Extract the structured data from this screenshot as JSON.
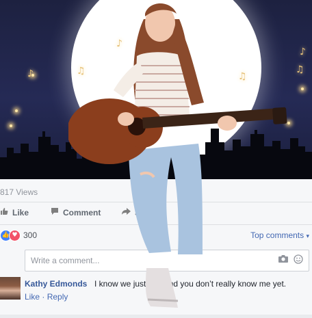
{
  "post": {
    "views": "817 Views"
  },
  "actions": {
    "like": "Like",
    "comment": "Comment",
    "share": "Share"
  },
  "reactions": {
    "count": "300",
    "top_comments": "Top comments"
  },
  "comment_box": {
    "placeholder": "Write a comment..."
  },
  "comment": {
    "author": "Kathy Edmonds",
    "text": "I know we just met and you don’t really know me yet.",
    "like": "Like",
    "separator": " · ",
    "reply": "Reply"
  },
  "icons": {
    "like_action": "thumbs-up-icon",
    "comment_action": "speech-bubble-icon",
    "share_action": "share-arrow-icon",
    "like_reaction": "like-reaction-icon",
    "love_reaction": "love-reaction-icon",
    "camera": "camera-icon",
    "emoji": "emoji-icon"
  },
  "colors": {
    "night_sky": "#1d2140",
    "moon": "#ffffff",
    "link_blue": "#4267b2",
    "name_blue": "#365899",
    "like_blue": "#4080ff",
    "love_red": "#f25268"
  }
}
